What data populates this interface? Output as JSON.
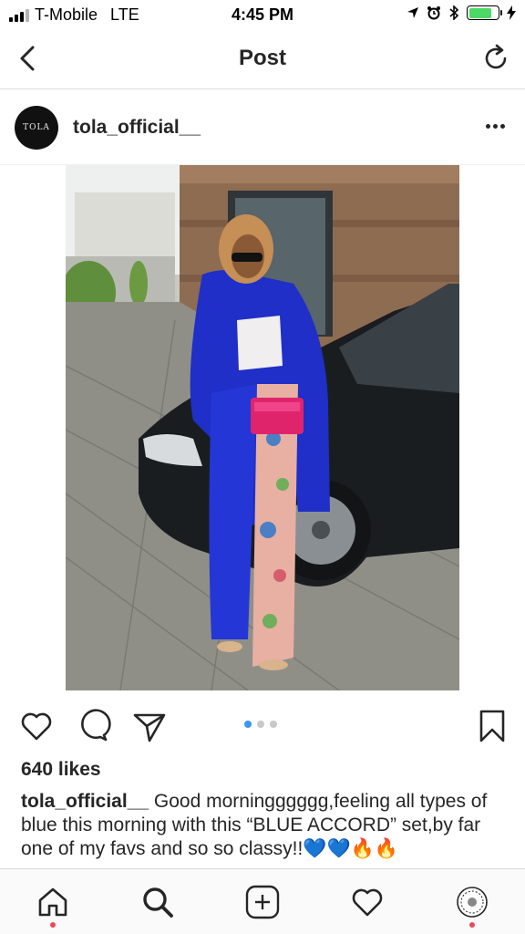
{
  "status_bar": {
    "carrier": "T-Mobile",
    "network": "LTE",
    "time": "4:45 PM",
    "battery_color": "#4cd964"
  },
  "nav": {
    "title": "Post",
    "back_icon": "chevron-left-icon",
    "refresh_icon": "refresh-icon"
  },
  "post": {
    "username": "tola_official__",
    "avatar_text": "TOLA",
    "more_icon": "ellipsis-icon",
    "photo_description_icon": "photo",
    "carousel": {
      "count": 3,
      "active_index": 0,
      "active_color": "#3897f0"
    },
    "likes": "640 likes",
    "caption_user": "tola_official__",
    "caption_text": " Good morningggggg,feeling all types of blue this morning with this “BLUE ACCORD” set,by far one of my favs and so so classy!!💙💙🔥🔥"
  },
  "tabbar": {
    "items": [
      "home-icon",
      "search-icon",
      "new-post-icon",
      "activity-icon",
      "profile-icon"
    ],
    "notification_color": "#ed4956"
  }
}
